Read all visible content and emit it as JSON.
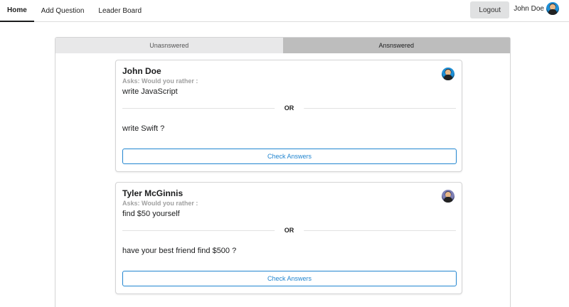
{
  "nav": {
    "items": [
      {
        "label": "Home",
        "active": true
      },
      {
        "label": "Add Question",
        "active": false
      },
      {
        "label": "Leader Board",
        "active": false
      }
    ],
    "logout_label": "Logout",
    "user_name": "John Doe"
  },
  "tabs": [
    {
      "label": "Unasnswered",
      "active": false
    },
    {
      "label": "Ansnswered",
      "active": true
    }
  ],
  "questions": [
    {
      "author": "John Doe",
      "asks": "Asks: Would you rather :",
      "option_one": "write JavaScript",
      "or_label": "OR",
      "option_two": "write Swift ?",
      "button_label": "Check Answers"
    },
    {
      "author": "Tyler McGinnis",
      "asks": "Asks: Would you rather :",
      "option_one": "find $50 yourself",
      "or_label": "OR",
      "option_two": "have your best friend find $500 ?",
      "button_label": "Check Answers"
    }
  ],
  "colors": {
    "accent": "#2185d0",
    "active_tab": "#bdbdbd",
    "inactive_tab": "#e8e8e9"
  }
}
